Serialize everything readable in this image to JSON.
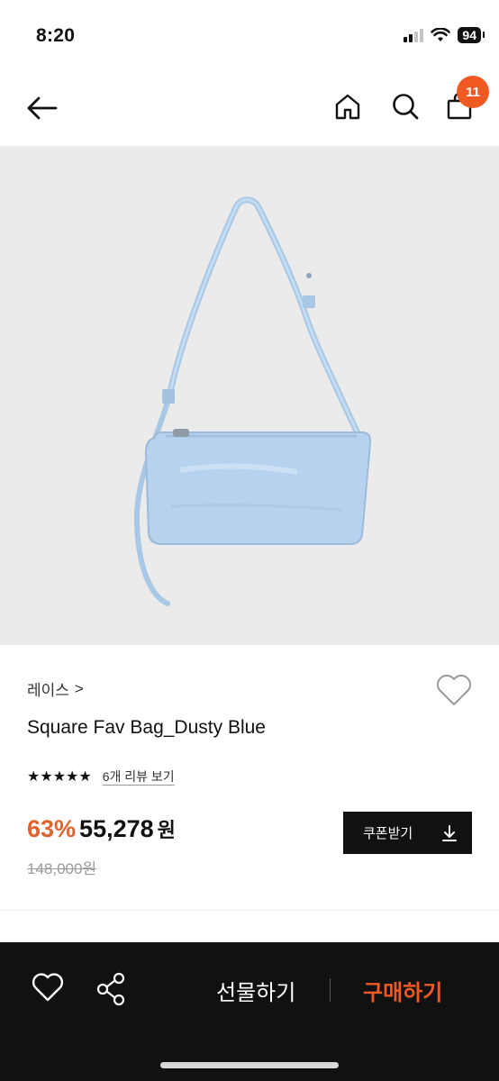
{
  "status_bar": {
    "time": "8:20",
    "battery": "94",
    "icons": [
      "signal-icon",
      "wifi-icon",
      "battery-icon"
    ]
  },
  "nav": {
    "back_icon": "arrow-left-icon",
    "home_icon": "home-icon",
    "search_icon": "search-icon",
    "cart_icon": "shopping-bag-icon",
    "cart_count": "11",
    "badge_color": "#f05a22"
  },
  "product": {
    "image_subject": "light blue shoulder bag",
    "brand": "레이스",
    "brand_chevron": ">",
    "title": "Square Fav Bag_Dusty Blue",
    "rating": 5,
    "stars": "★★★★★",
    "review_link": "6개 리뷰 보기",
    "discount": "63%",
    "price": "55,278",
    "currency": "원",
    "original_price": "148,000원",
    "coupon_label": "쿠폰받기",
    "coupon_icon": "download-icon",
    "accent_color": "#e2622f"
  },
  "bottom_bar": {
    "wish_icon": "heart-icon",
    "share_icon": "share-icon",
    "gift_label": "선물하기",
    "buy_label": "구매하기",
    "buy_color": "#f05a22"
  }
}
